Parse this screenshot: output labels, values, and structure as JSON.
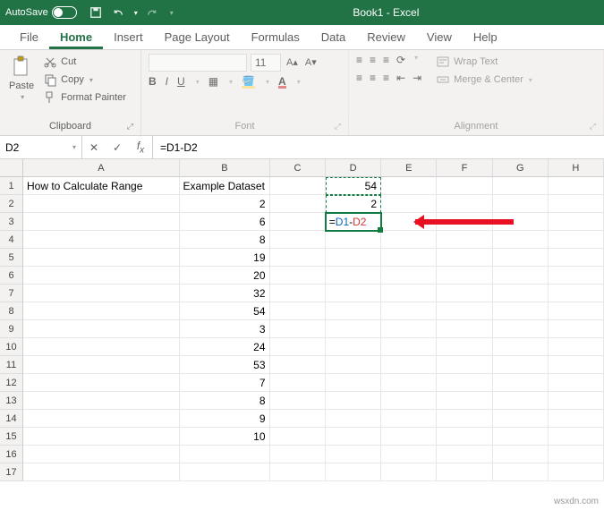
{
  "titlebar": {
    "autosave": "AutoSave",
    "title": "Book1 - Excel"
  },
  "tabs": [
    "File",
    "Home",
    "Insert",
    "Page Layout",
    "Formulas",
    "Data",
    "Review",
    "View",
    "Help"
  ],
  "ribbon": {
    "clipboard": {
      "paste": "Paste",
      "cut": "Cut",
      "copy": "Copy",
      "format_painter": "Format Painter",
      "label": "Clipboard"
    },
    "font": {
      "family": "",
      "size": "11",
      "label": "Font"
    },
    "alignment": {
      "wrap": "Wrap Text",
      "merge": "Merge & Center",
      "label": "Alignment"
    }
  },
  "namebox": "D2",
  "formula": "=D1-D2",
  "columns": [
    "A",
    "B",
    "C",
    "D",
    "E",
    "F",
    "G",
    "H"
  ],
  "rows": [
    "1",
    "2",
    "3",
    "4",
    "5",
    "6",
    "7",
    "8",
    "9",
    "10",
    "11",
    "12",
    "13",
    "14",
    "15",
    "16",
    "17"
  ],
  "cells": {
    "A1": "How to Calculate Range",
    "B1": "Example Dataset",
    "B2": "2",
    "B3": "6",
    "B4": "8",
    "B5": "19",
    "B6": "20",
    "B7": "32",
    "B8": "54",
    "B9": "3",
    "B10": "24",
    "B11": "53",
    "B12": "7",
    "B13": "8",
    "B14": "9",
    "B15": "10",
    "D1": "54",
    "D2": "2"
  },
  "edit_formula": {
    "prefix": "=",
    "ref1": "D1",
    "op": "-",
    "ref2": "D2"
  },
  "watermark": "wsxdn.com"
}
